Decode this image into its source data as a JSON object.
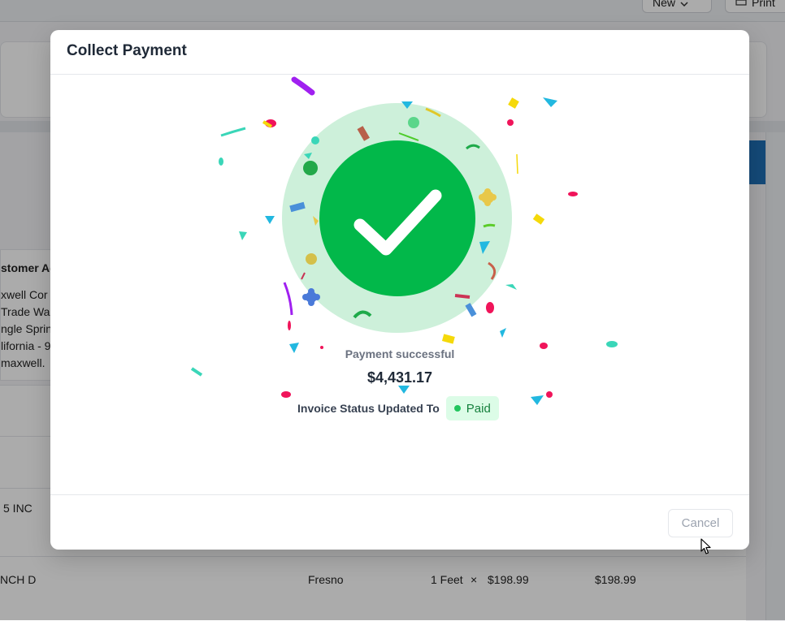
{
  "background": {
    "new_button": "New",
    "print_button": "Print",
    "address_heading": "stomer Ad",
    "address_lines": [
      "xwell Cor",
      " Trade Wa",
      "ngle Sprin",
      "lifornia - 9",
      " maxwell."
    ],
    "row1_name": "5 INC",
    "row2_name": "NCH D",
    "row2_city": "Fresno",
    "row2_qty": "1 Feet",
    "row2_times": "×",
    "row2_rate": "$198.99",
    "row2_amount": "$198.99"
  },
  "modal": {
    "title": "Collect Payment",
    "status_text": "Payment successful",
    "amount": "$4,431.17",
    "invoice_label": "Invoice Status Updated To",
    "badge_label": "Paid",
    "cancel_label": "Cancel"
  },
  "colors": {
    "success_green": "#02b84a",
    "success_ring": "#cdf0da",
    "badge_bg": "#dcfce7",
    "badge_text": "#15803d"
  },
  "icons": {
    "check": "check-icon",
    "cursor": "mouse-pointer-icon",
    "chevron": "chevron-down-icon",
    "printer": "printer-icon"
  }
}
